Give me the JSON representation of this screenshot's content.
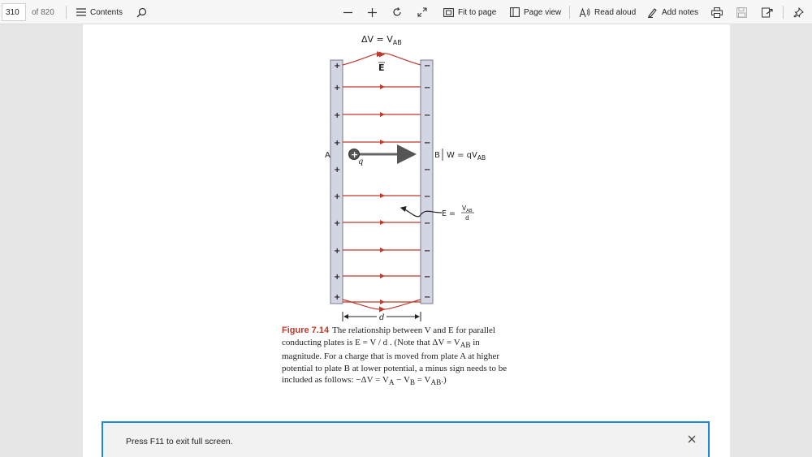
{
  "toolbar": {
    "page_number": "310",
    "page_total": "of 820",
    "contents_label": "Contents",
    "fit_to_page_label": "Fit to page",
    "page_view_label": "Page view",
    "read_aloud_label": "Read aloud",
    "add_notes_label": "Add notes"
  },
  "figure": {
    "top_label": "ΔV = V",
    "top_label_sub": "AB",
    "field_label": "E",
    "plus_sign": "+",
    "minus_sign": "−",
    "label_a": "A",
    "label_b": "B",
    "label_q": "q",
    "work_label": "W = qV",
    "work_sub": "AB",
    "efield_eq": "E =",
    "efield_num": "V",
    "efield_num_sub": "AB",
    "efield_den": "d",
    "distance_label": "d"
  },
  "caption": {
    "figure_label": "Figure 7.14",
    "line1": "The relationship between V and E for parallel",
    "line2": "conducting plates is E = V / d . (Note that ΔV = V",
    "line2_sub": "AB",
    "line2_end": " in",
    "line3": "magnitude. For a charge that is moved from plate A at higher",
    "line4": "potential to plate B at lower potential, a minus sign needs to be",
    "line5": "included as follows: −ΔV = V",
    "line5_sub_a": "A",
    "line5_mid": " − V",
    "line5_sub_b": "B",
    "line5_mid2": " = V",
    "line5_sub_c": "AB",
    "line5_end": ".)"
  },
  "banner": {
    "message": "Press F11 to exit full screen."
  },
  "colors": {
    "field_line": "#c0392b",
    "plate": "#cfd0e0",
    "accent": "#1e88e5"
  },
  "icons": [
    "menu-icon",
    "search-icon",
    "minus-icon",
    "plus-icon",
    "rotate-icon",
    "fullscreen-icon",
    "fit-page-icon",
    "page-view-icon",
    "read-aloud-icon",
    "add-notes-icon",
    "print-icon",
    "save-icon",
    "share-icon",
    "pin-icon",
    "close-icon"
  ]
}
